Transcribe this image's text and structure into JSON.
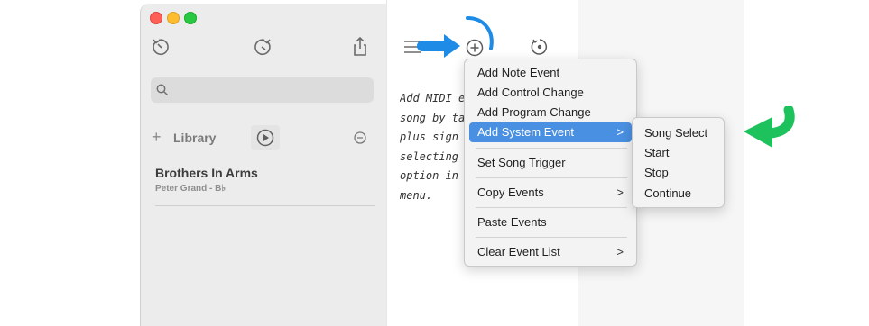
{
  "sidebar": {
    "library_label": "Library",
    "song": {
      "title": "Brothers In Arms",
      "subtitle": "Peter Grand - B♭"
    }
  },
  "help_text_lines": [
    "Add MIDI e",
    "song by ta",
    "plus sign c",
    "selecting t",
    "option in t",
    "menu."
  ],
  "context_menu": {
    "items": [
      {
        "label": "Add Note Event"
      },
      {
        "label": "Add Control Change"
      },
      {
        "label": "Add Program Change"
      },
      {
        "label": "Add System Event",
        "chevron": ">"
      },
      {
        "label": "Set Song Trigger"
      },
      {
        "label": "Copy Events",
        "chevron": ">"
      },
      {
        "label": "Paste Events"
      },
      {
        "label": "Clear Event List",
        "chevron": ">"
      }
    ],
    "highlighted": "Add System Event"
  },
  "submenu": {
    "items": [
      "Song Select",
      "Start",
      "Stop",
      "Continue"
    ]
  },
  "colors": {
    "highlight": "#4a90e2",
    "blue_arrow": "#1e8be6",
    "green_arrow": "#1ec25c"
  },
  "icons": [
    "history-back-icon",
    "history-forward-icon",
    "share-icon",
    "search-icon",
    "plus-icon",
    "play-icon",
    "minus-circle-icon",
    "hamburger-menu-icon",
    "add-circle-icon",
    "target-icon"
  ]
}
